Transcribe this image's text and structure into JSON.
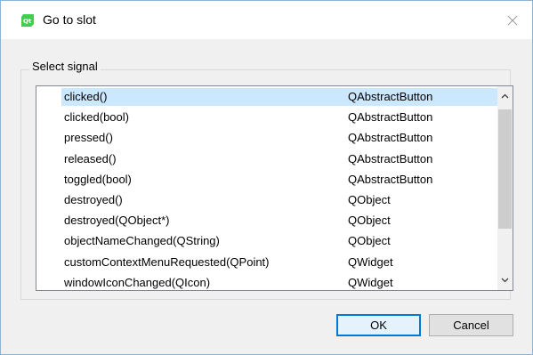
{
  "window": {
    "title": "Go to slot",
    "app_icon": "qt-icon",
    "accent": "#0078d7"
  },
  "group": {
    "label": "Select signal"
  },
  "signals": [
    {
      "signal": "clicked()",
      "class": "QAbstractButton",
      "selected": true
    },
    {
      "signal": "clicked(bool)",
      "class": "QAbstractButton"
    },
    {
      "signal": "pressed()",
      "class": "QAbstractButton"
    },
    {
      "signal": "released()",
      "class": "QAbstractButton"
    },
    {
      "signal": "toggled(bool)",
      "class": "QAbstractButton"
    },
    {
      "signal": "destroyed()",
      "class": "QObject"
    },
    {
      "signal": "destroyed(QObject*)",
      "class": "QObject"
    },
    {
      "signal": "objectNameChanged(QString)",
      "class": "QObject"
    },
    {
      "signal": "customContextMenuRequested(QPoint)",
      "class": "QWidget"
    },
    {
      "signal": "windowIconChanged(QIcon)",
      "class": "QWidget"
    }
  ],
  "buttons": {
    "ok": "OK",
    "cancel": "Cancel"
  }
}
